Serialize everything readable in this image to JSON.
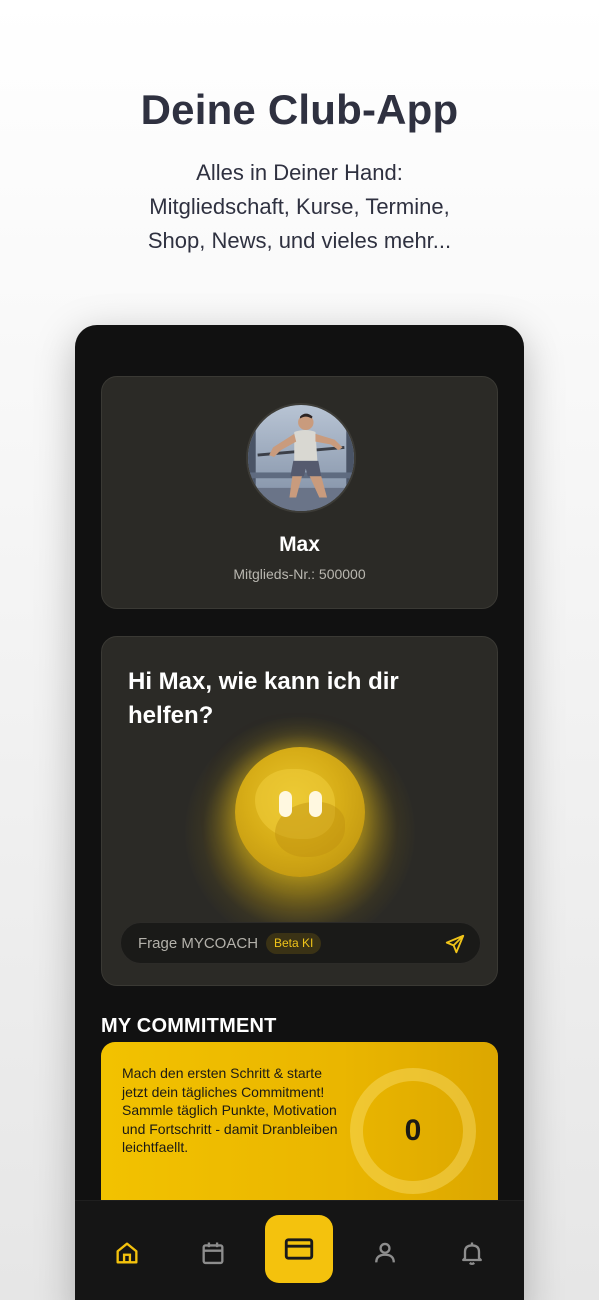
{
  "promo": {
    "headline": "Deine Club-App",
    "subline": [
      "Alles in Deiner Hand:",
      "Mitgliedschaft, Kurse, Termine,",
      "Shop, News, und vieles mehr..."
    ]
  },
  "profile": {
    "name": "Max",
    "member_number": "Mitglieds-Nr.: 500000"
  },
  "coach": {
    "greeting": "Hi Max, wie kann ich dir helfen?",
    "input_placeholder": "Frage MYCOACH",
    "badge": "Beta KI"
  },
  "commitment": {
    "title": "MY COMMITMENT",
    "text": "Mach den ersten Schritt & starte jetzt dein tägliches Commitment! Sammle täglich Punkte, Motivation und Fortschritt - damit Dranbleiben leichtfaellt.",
    "count": "0"
  },
  "tabbar": {
    "items": [
      "home-icon",
      "calendar-icon",
      "membership-card-icon",
      "profile-icon",
      "bell-icon"
    ],
    "active": "home-icon"
  },
  "colors": {
    "accent": "#f4c20d",
    "background_dark": "#111111",
    "card": "#2b2a26"
  }
}
